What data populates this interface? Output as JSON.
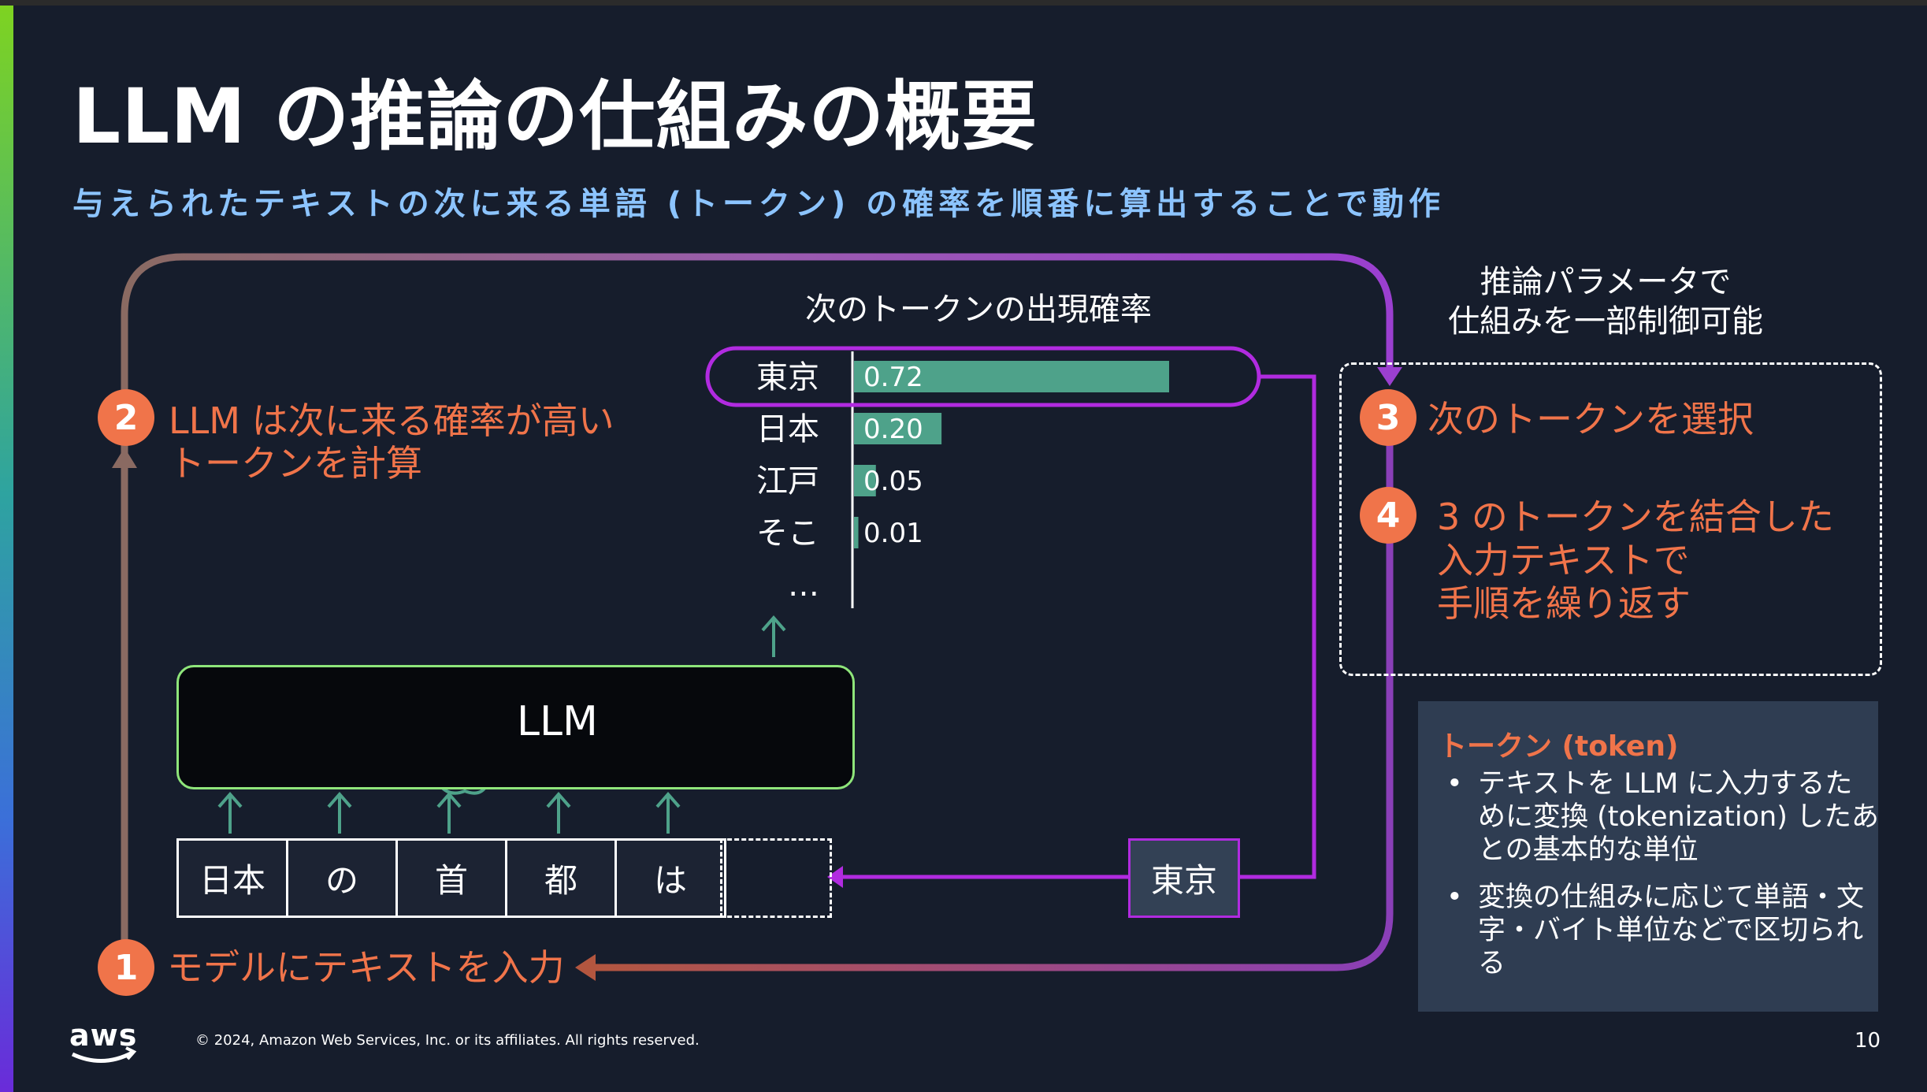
{
  "slide": {
    "title": "LLM の推論の仕組みの概要",
    "subtitle": "与えられたテキストの次に来る単語 (トークン) の確率を順番に算出することで動作",
    "page_number": "10",
    "copyright": "© 2024, Amazon Web Services, Inc. or its affiliates. All rights reserved.",
    "logo": "aws"
  },
  "steps": [
    {
      "number": "1",
      "text": "モデルにテキストを入力"
    },
    {
      "number": "2",
      "line1": "LLM は次に来る確率が高い",
      "line2": "トークンを計算"
    },
    {
      "number": "3",
      "text": "次のトークンを選択"
    },
    {
      "number": "4",
      "line1": "3 のトークンを結合した",
      "line2": "入力テキストで",
      "line3": "手順を繰り返す"
    }
  ],
  "param_note": {
    "line1": "推論パラメータで",
    "line2": "仕組みを一部制御可能"
  },
  "llm_label": "LLM",
  "input_tokens": [
    "日本",
    "の",
    "首",
    "都",
    "は"
  ],
  "selected_token": "東京",
  "info": {
    "title": "トークン (token)",
    "bullets": [
      "テキストを LLM に入力するために変換 (tokenization) したあとの基本的な単位",
      "変換の仕組みに応じて単語・文字・バイト単位などで区切られる"
    ]
  },
  "colors": {
    "accent": "#f0744a",
    "bar": "#4ea28a",
    "highlight": "#b12be0",
    "subtitle": "#8cc4ff",
    "llm_border": "#8ee57a"
  },
  "chart_data": {
    "type": "bar",
    "title": "次のトークンの出現確率",
    "orientation": "horizontal",
    "categories": [
      "東京",
      "日本",
      "江戸",
      "そこ",
      "…"
    ],
    "values": [
      0.72,
      0.2,
      0.05,
      0.01,
      null
    ],
    "value_labels": [
      "0.72",
      "0.20",
      "0.05",
      "0.01",
      ""
    ],
    "xlim": [
      0,
      1
    ],
    "highlighted": "東京"
  }
}
